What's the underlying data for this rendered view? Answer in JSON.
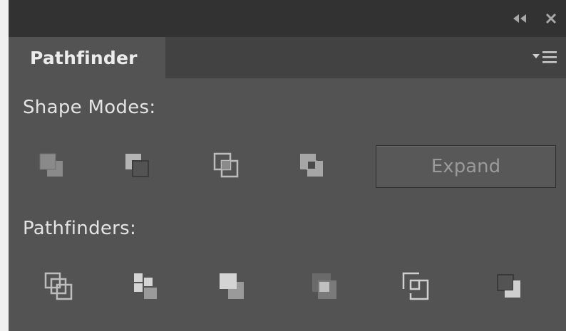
{
  "panel": {
    "tab_label": "Pathfinder",
    "collapse_glyph": "◂◂",
    "close_glyph": "✕"
  },
  "shape_modes": {
    "label": "Shape Modes:",
    "buttons": [
      "unite-icon",
      "minus-front-icon",
      "intersect-icon",
      "exclude-icon"
    ],
    "expand_label": "Expand"
  },
  "pathfinders": {
    "label": "Pathfinders:",
    "buttons": [
      "divide-icon",
      "trim-icon",
      "merge-icon",
      "crop-icon",
      "outline-icon",
      "minus-back-icon"
    ]
  },
  "colors": {
    "panel_bg": "#535353",
    "titlebar_bg": "#323232",
    "tabstrip_bg": "#424242",
    "icon_light": "#cfcfcf",
    "icon_dark": "#8a8a8a"
  }
}
